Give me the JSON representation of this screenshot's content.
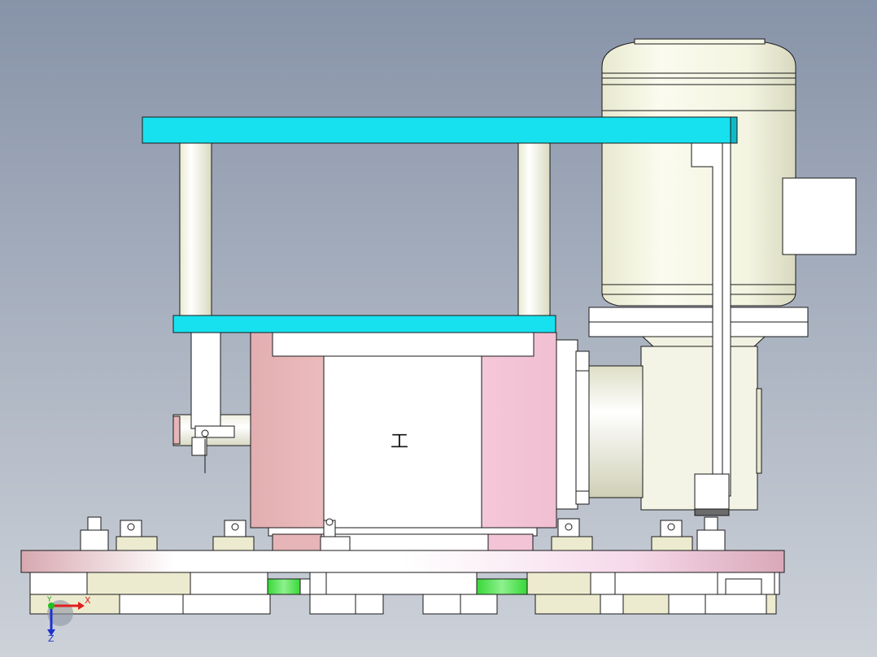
{
  "colors": {
    "background_top": "#8793a8",
    "background_bottom": "#cdd2d9",
    "cyan_plate": "#17e1ef",
    "pink_block": "#e6b5b7",
    "pink_block_light": "#f2c4d5",
    "base_plate": "#e7c5cc",
    "green_marker": "#4ce04c",
    "motor_body": "#f7f8e6",
    "part_cream": "#ecebcf",
    "axis_x": "#e02020",
    "axis_y": "#20c020",
    "axis_z": "#2030d0"
  },
  "triad": {
    "x_label": "X",
    "y_label": "Y",
    "z_label": "Z"
  },
  "block_symbol": "工"
}
